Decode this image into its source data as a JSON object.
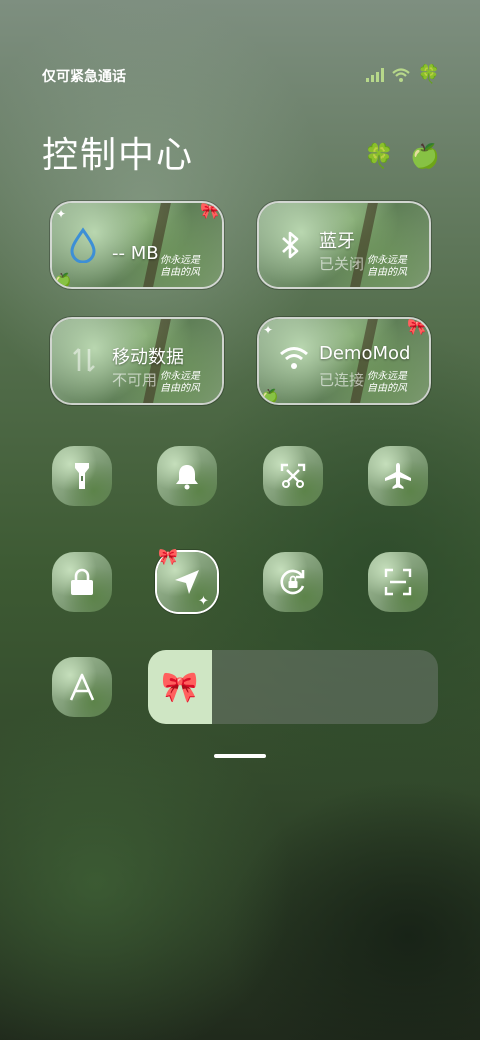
{
  "status": {
    "carrier": "仅可紧急通话",
    "clover": "🍀"
  },
  "title": "控制中心",
  "title_emojis": [
    "🍀",
    "🍏"
  ],
  "tiles": {
    "data_usage": {
      "title": "-- MB",
      "sub": ""
    },
    "bluetooth": {
      "title": "蓝牙",
      "sub": "已关闭"
    },
    "mobile_data": {
      "title": "移动数据",
      "sub": "不可用"
    },
    "wifi": {
      "title": "DemoMod",
      "sub": "已连接"
    }
  },
  "signature": [
    "你永远是",
    "自由的风"
  ],
  "slider": {
    "emoji": "🎀",
    "level": 0.22
  },
  "colors": {
    "accent_fill": "#cfe6c4",
    "water_drop": "#3d8fd6"
  }
}
